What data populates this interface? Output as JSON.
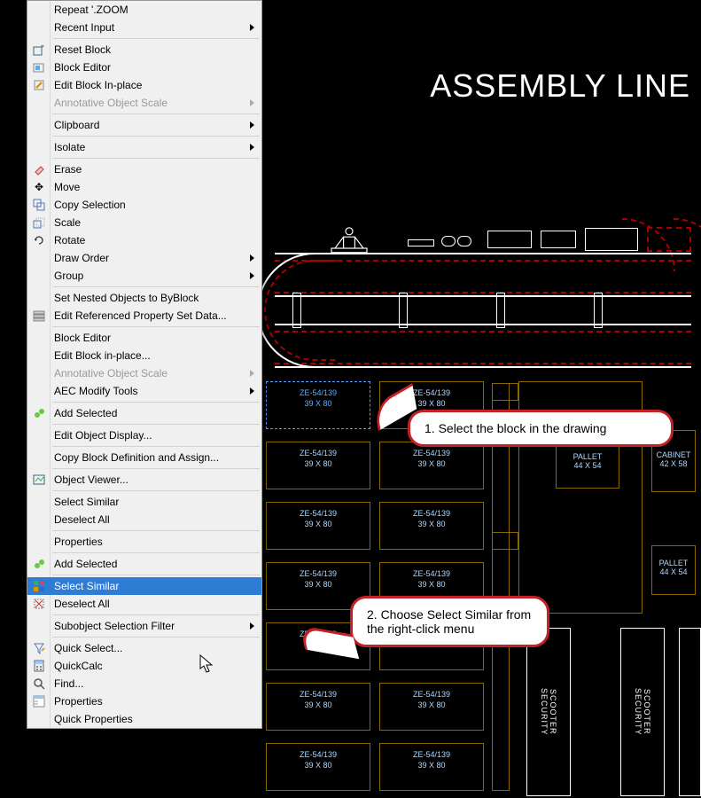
{
  "drawing": {
    "title": "ASSEMBLY LINE",
    "selected_block": {
      "code": "ZE-54/139",
      "size": "39 X 80"
    },
    "block_label": {
      "code": "ZE-54/139",
      "size": "39 X 80"
    },
    "cabinet": {
      "label": "CABINET",
      "size": "42 X 58"
    },
    "pallet1": {
      "label": "PALLET",
      "size": "44 X 54"
    },
    "pallet2": {
      "label": "PALLET",
      "size": "44 X 54"
    },
    "scooter": "SCOOTER\nSECURITY"
  },
  "callouts": {
    "c1": "1.  Select the block in the drawing",
    "c2": "2.  Choose Select Similar from the right-click menu"
  },
  "menu": {
    "repeat": "Repeat '.ZOOM",
    "recent_input": "Recent Input",
    "reset_block": "Reset Block",
    "block_editor": "Block Editor",
    "edit_block_inplace": "Edit Block In-place",
    "annot_scale": "Annotative Object Scale",
    "clipboard": "Clipboard",
    "isolate": "Isolate",
    "erase": "Erase",
    "move": "Move",
    "copy_sel": "Copy Selection",
    "scale": "Scale",
    "rotate": "Rotate",
    "draw_order": "Draw Order",
    "group": "Group",
    "set_nested": "Set Nested Objects to ByBlock",
    "edit_ref_prop": "Edit Referenced Property Set Data...",
    "block_editor2": "Block Editor",
    "edit_block_inplace2": "Edit Block in-place...",
    "annot_scale2": "Annotative Object Scale",
    "aec_modify": "AEC Modify Tools",
    "add_selected": "Add Selected",
    "edit_obj_disp": "Edit Object Display...",
    "copy_block_def": "Copy Block Definition and Assign...",
    "obj_viewer": "Object Viewer...",
    "select_similar": "Select Similar",
    "deselect_all": "Deselect All",
    "properties": "Properties",
    "add_selected2": "Add Selected",
    "select_similar2": "Select Similar",
    "deselect_all2": "Deselect All",
    "subobj_filter": "Subobject Selection Filter",
    "quick_select": "Quick Select...",
    "quickcalc": "QuickCalc",
    "find": "Find...",
    "properties2": "Properties",
    "quick_props": "Quick Properties"
  }
}
